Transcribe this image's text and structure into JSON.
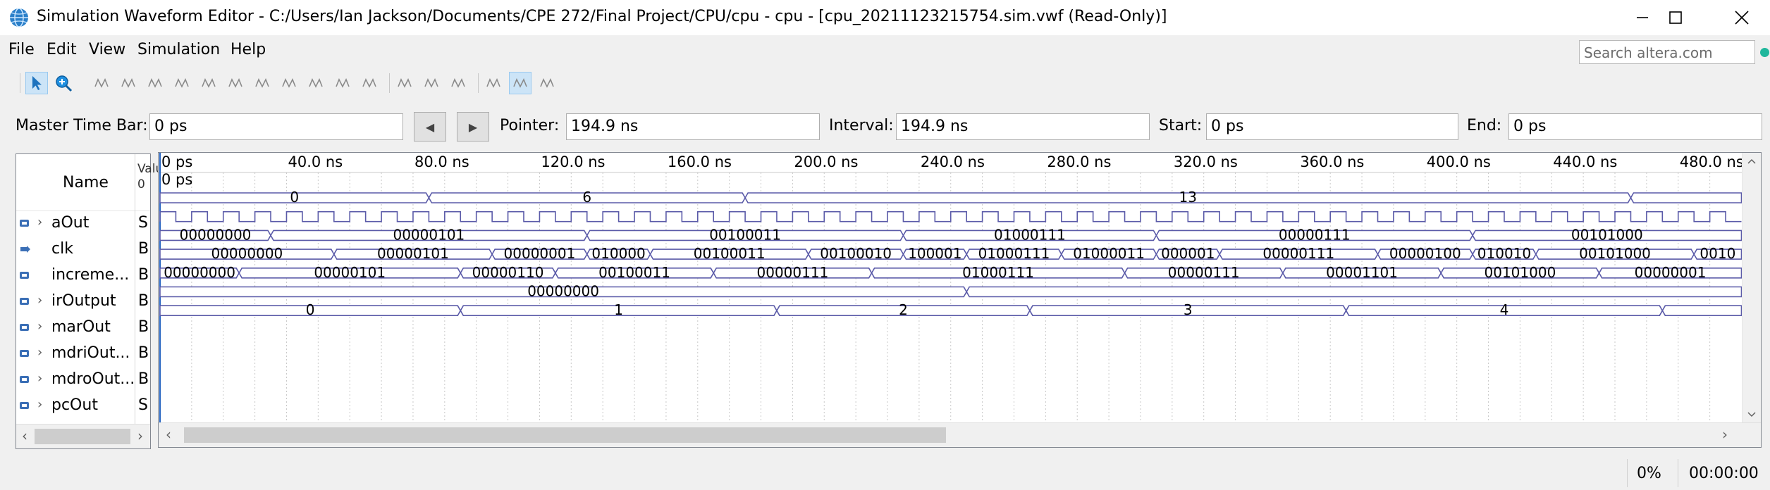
{
  "window": {
    "title": "Simulation Waveform Editor - C:/Users/Ian Jackson/Documents/CPE 272/Final Project/CPU/cpu - cpu - [cpu_20211123215754.sim.vwf (Read-Only)]",
    "app_icon": "quartus-globe-icon",
    "controls": [
      "minimize-icon",
      "maximize-icon",
      "close-icon"
    ]
  },
  "menu": [
    "File",
    "Edit",
    "View",
    "Simulation",
    "Help"
  ],
  "search": {
    "placeholder": "Search altera.com"
  },
  "toolbar": {
    "tools": [
      "selection-tool-icon",
      "zoom-tool-icon",
      "force-unknown-icon",
      "force-low-icon",
      "force-high-icon",
      "force-high-impedance-icon",
      "force-weak-low-icon",
      "force-weak-high-icon",
      "force-dont-care-icon",
      "invert-icon",
      "count-value-icon",
      "clock-icon",
      "arbitrary-value-icon",
      "random-value-icon",
      "functional-simulation-icon",
      "timing-simulation-icon",
      "netlist-viewer-icon",
      "snap-to-grid-icon",
      "grid-settings-icon"
    ]
  },
  "timebar": {
    "master_label": "Master Time Bar:",
    "master_value": "0 ps",
    "pointer_label": "Pointer:",
    "pointer_value": "194.9 ns",
    "interval_label": "Interval:",
    "interval_value": "194.9 ns",
    "start_label": "Start:",
    "start_value": "0 ps",
    "end_label": "End:",
    "end_value": "0 ps"
  },
  "name_panel": {
    "header": "Name",
    "value_header_lines": [
      "Valu",
      "0"
    ],
    "signals": [
      {
        "name": "aOut",
        "value": "S",
        "expandable": true,
        "icon": "bus-output-icon"
      },
      {
        "name": "clk",
        "value": "B",
        "expandable": false,
        "icon": "input-pin-icon"
      },
      {
        "name": "increme...",
        "value": "B",
        "expandable": false,
        "icon": "bus-output-icon"
      },
      {
        "name": "irOutput",
        "value": "B",
        "expandable": true,
        "icon": "bus-output-icon"
      },
      {
        "name": "marOut",
        "value": "B",
        "expandable": true,
        "icon": "bus-output-icon"
      },
      {
        "name": "mdriOut...",
        "value": "B",
        "expandable": true,
        "icon": "bus-output-icon"
      },
      {
        "name": "mdroOut...",
        "value": "B",
        "expandable": true,
        "icon": "bus-output-icon"
      },
      {
        "name": "pcOut",
        "value": "S",
        "expandable": true,
        "icon": "bus-output-icon"
      }
    ]
  },
  "waveform": {
    "time_unit": "ns",
    "view_start_ns": 0,
    "view_end_ns": 500,
    "ruler_labels": [
      {
        "t": 0,
        "label": "0 ps"
      },
      {
        "t": 40,
        "label": "40.0 ns"
      },
      {
        "t": 80,
        "label": "80.0 ns"
      },
      {
        "t": 120,
        "label": "120.0 ns"
      },
      {
        "t": 160,
        "label": "160.0 ns"
      },
      {
        "t": 200,
        "label": "200.0 ns"
      },
      {
        "t": 240,
        "label": "240.0 ns"
      },
      {
        "t": 280,
        "label": "280.0 ns"
      },
      {
        "t": 320,
        "label": "320.0 ns"
      },
      {
        "t": 360,
        "label": "360.0 ns"
      },
      {
        "t": 400,
        "label": "400.0 ns"
      },
      {
        "t": 440,
        "label": "440.0 ns"
      },
      {
        "t": 480,
        "label": "480.0 ns"
      }
    ],
    "master_marker_label": "0 ps",
    "clock_period_ns": 10,
    "rows": [
      {
        "signal": "aOut",
        "segments": [
          [
            0,
            85,
            "0"
          ],
          [
            85,
            185,
            "6"
          ],
          [
            185,
            465,
            "13"
          ],
          [
            465,
            500,
            ""
          ]
        ]
      },
      {
        "signal": "clk",
        "clock": true
      },
      {
        "signal": "increme...",
        "segments": [
          [
            0,
            35,
            "00000000"
          ],
          [
            35,
            135,
            "00000101"
          ],
          [
            135,
            235,
            "00100011"
          ],
          [
            235,
            315,
            "01000111"
          ],
          [
            315,
            415,
            "00000111"
          ],
          [
            415,
            500,
            "00101000"
          ]
        ]
      },
      {
        "signal": "irOutput",
        "segments": [
          [
            0,
            55,
            "00000000"
          ],
          [
            55,
            105,
            "00000101"
          ],
          [
            105,
            135,
            "00000001"
          ],
          [
            135,
            155,
            "010000"
          ],
          [
            155,
            205,
            "00100011"
          ],
          [
            205,
            235,
            "00100010"
          ],
          [
            235,
            255,
            "100001"
          ],
          [
            255,
            285,
            "01000111"
          ],
          [
            285,
            315,
            "01000011"
          ],
          [
            315,
            335,
            "000001"
          ],
          [
            335,
            385,
            "00000111"
          ],
          [
            385,
            415,
            "00000100"
          ],
          [
            415,
            435,
            "010010"
          ],
          [
            435,
            485,
            "00101000"
          ],
          [
            485,
            500,
            "0010"
          ]
        ]
      },
      {
        "signal": "marOut",
        "segments": [
          [
            0,
            25,
            "00000000"
          ],
          [
            25,
            95,
            "00000101"
          ],
          [
            95,
            125,
            "00000110"
          ],
          [
            125,
            175,
            "00100011"
          ],
          [
            175,
            225,
            "00000111"
          ],
          [
            225,
            305,
            "01000111"
          ],
          [
            305,
            355,
            "00000111"
          ],
          [
            355,
            405,
            "00001101"
          ],
          [
            405,
            455,
            "00101000"
          ],
          [
            455,
            500,
            "00000001"
          ]
        ]
      },
      {
        "signal": "mdriOut...",
        "segments": [
          [
            0,
            255,
            "00000000"
          ],
          [
            255,
            500,
            ""
          ]
        ]
      },
      {
        "signal": "mdroOut...",
        "segments": [
          [
            0,
            95,
            "0"
          ],
          [
            95,
            195,
            "1"
          ],
          [
            195,
            275,
            "2"
          ],
          [
            275,
            375,
            "3"
          ],
          [
            375,
            475,
            "4"
          ],
          [
            475,
            500,
            ""
          ]
        ]
      },
      {
        "signal": "pcOut",
        "segments": []
      }
    ]
  },
  "status": {
    "progress": "0%",
    "elapsed": "00:00:00"
  }
}
